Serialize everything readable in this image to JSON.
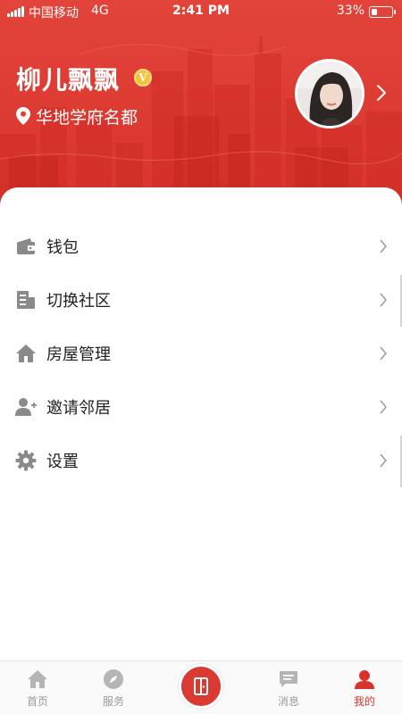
{
  "status_bar": {
    "carrier": "中国移动",
    "network": "4G",
    "time": "2:41 PM",
    "battery": "33%",
    "battery_level": 0.33
  },
  "profile": {
    "name": "柳儿飘飘",
    "badge": "V",
    "location": "华地学府名都",
    "avatar_icon": "user-avatar-photo",
    "chevron_icon": "chevron-right-icon"
  },
  "menu": {
    "items": [
      {
        "label": "钱包",
        "icon": "wallet-icon"
      },
      {
        "label": "切换社区",
        "icon": "building-icon"
      },
      {
        "label": "房屋管理",
        "icon": "home-icon"
      },
      {
        "label": "邀请邻居",
        "icon": "add-user-icon"
      },
      {
        "label": "设置",
        "icon": "gear-icon"
      }
    ]
  },
  "tabbar": {
    "items": [
      {
        "label": "首页",
        "icon": "home-icon",
        "active": false
      },
      {
        "label": "服务",
        "icon": "compass-icon",
        "active": false
      },
      {
        "label": "",
        "icon": "door-icon",
        "active": false
      },
      {
        "label": "消息",
        "icon": "message-icon",
        "active": false
      },
      {
        "label": "我的",
        "icon": "person-icon",
        "active": true
      }
    ]
  },
  "colors": {
    "brand_red": "#d9342c",
    "header_red": "#e2443a",
    "badge_gold": "#f5c339",
    "icon_gray": "#8a8a8a",
    "tab_inactive": "#9a9a9a"
  }
}
